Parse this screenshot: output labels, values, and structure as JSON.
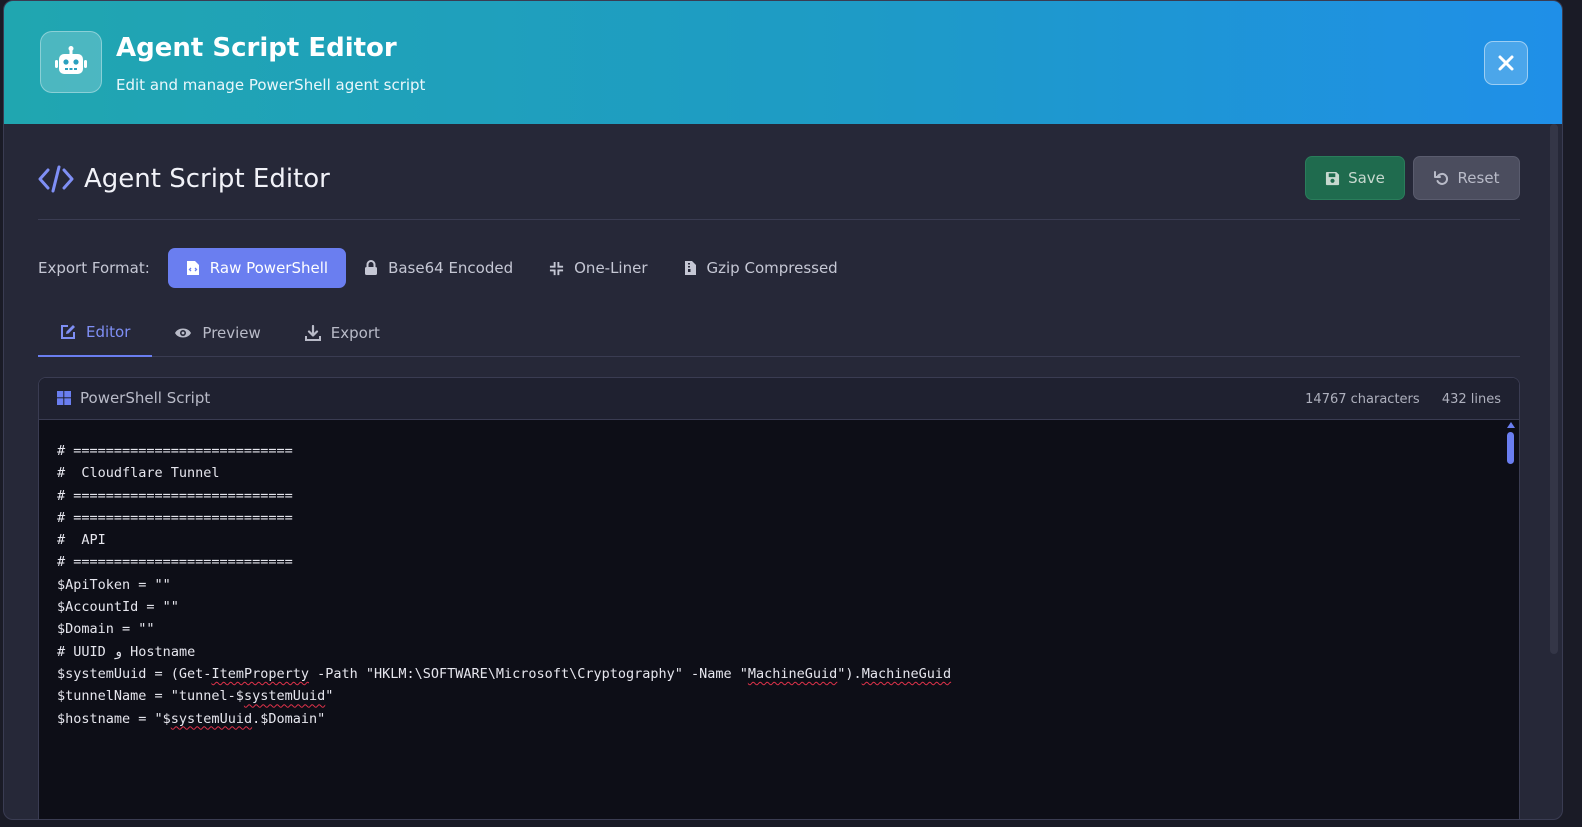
{
  "header": {
    "title": "Agent Script Editor",
    "subtitle": "Edit and manage PowerShell agent script",
    "logo_icon": "robot-icon",
    "close_icon": "close-icon"
  },
  "toolbar": {
    "page_title": "Agent Script Editor",
    "save_label": "Save",
    "reset_label": "Reset"
  },
  "export_format": {
    "label": "Export Format:",
    "options": [
      {
        "label": "Raw PowerShell",
        "icon": "file-code-icon",
        "active": true
      },
      {
        "label": "Base64 Encoded",
        "icon": "lock-icon",
        "active": false
      },
      {
        "label": "One-Liner",
        "icon": "compress-icon",
        "active": false
      },
      {
        "label": "Gzip Compressed",
        "icon": "file-zip-icon",
        "active": false
      }
    ]
  },
  "tabs": [
    {
      "label": "Editor",
      "icon": "edit-icon",
      "active": true
    },
    {
      "label": "Preview",
      "icon": "eye-icon",
      "active": false
    },
    {
      "label": "Export",
      "icon": "download-icon",
      "active": false
    }
  ],
  "editor": {
    "title": "PowerShell Script",
    "characters": "14767 characters",
    "lines": "432 lines",
    "code_lines": [
      "# ===========================",
      "#  Cloudflare Tunnel",
      "# ===========================",
      "",
      "# ===========================",
      "#  API",
      "# ===========================",
      "$ApiToken = \"\"",
      "$AccountId = \"\"",
      "$Domain = \"\"",
      "",
      "# UUID و Hostname"
    ],
    "line_system_uuid": {
      "prefix": "$systemUuid = (Get-",
      "squig1": "ItemProperty",
      "mid": " -Path \"HKLM:\\SOFTWARE\\Microsoft\\Cryptography\" -Name \"",
      "squig2": "MachineGuid",
      "mid2": "\").",
      "squig3": "MachineGuid"
    },
    "line_tunnel_name": {
      "prefix": "$tunnelName = \"tunnel-$",
      "squig": "systemUuid",
      "suffix": "\""
    },
    "line_hostname": {
      "prefix": "$hostname = \"$",
      "squig": "systemUuid",
      "suffix": ".$Domain\""
    }
  },
  "colors": {
    "accent": "#6a7ef0",
    "save": "#1f6b4e",
    "header_start": "#20a6b0",
    "header_end": "#1f8fe8"
  }
}
